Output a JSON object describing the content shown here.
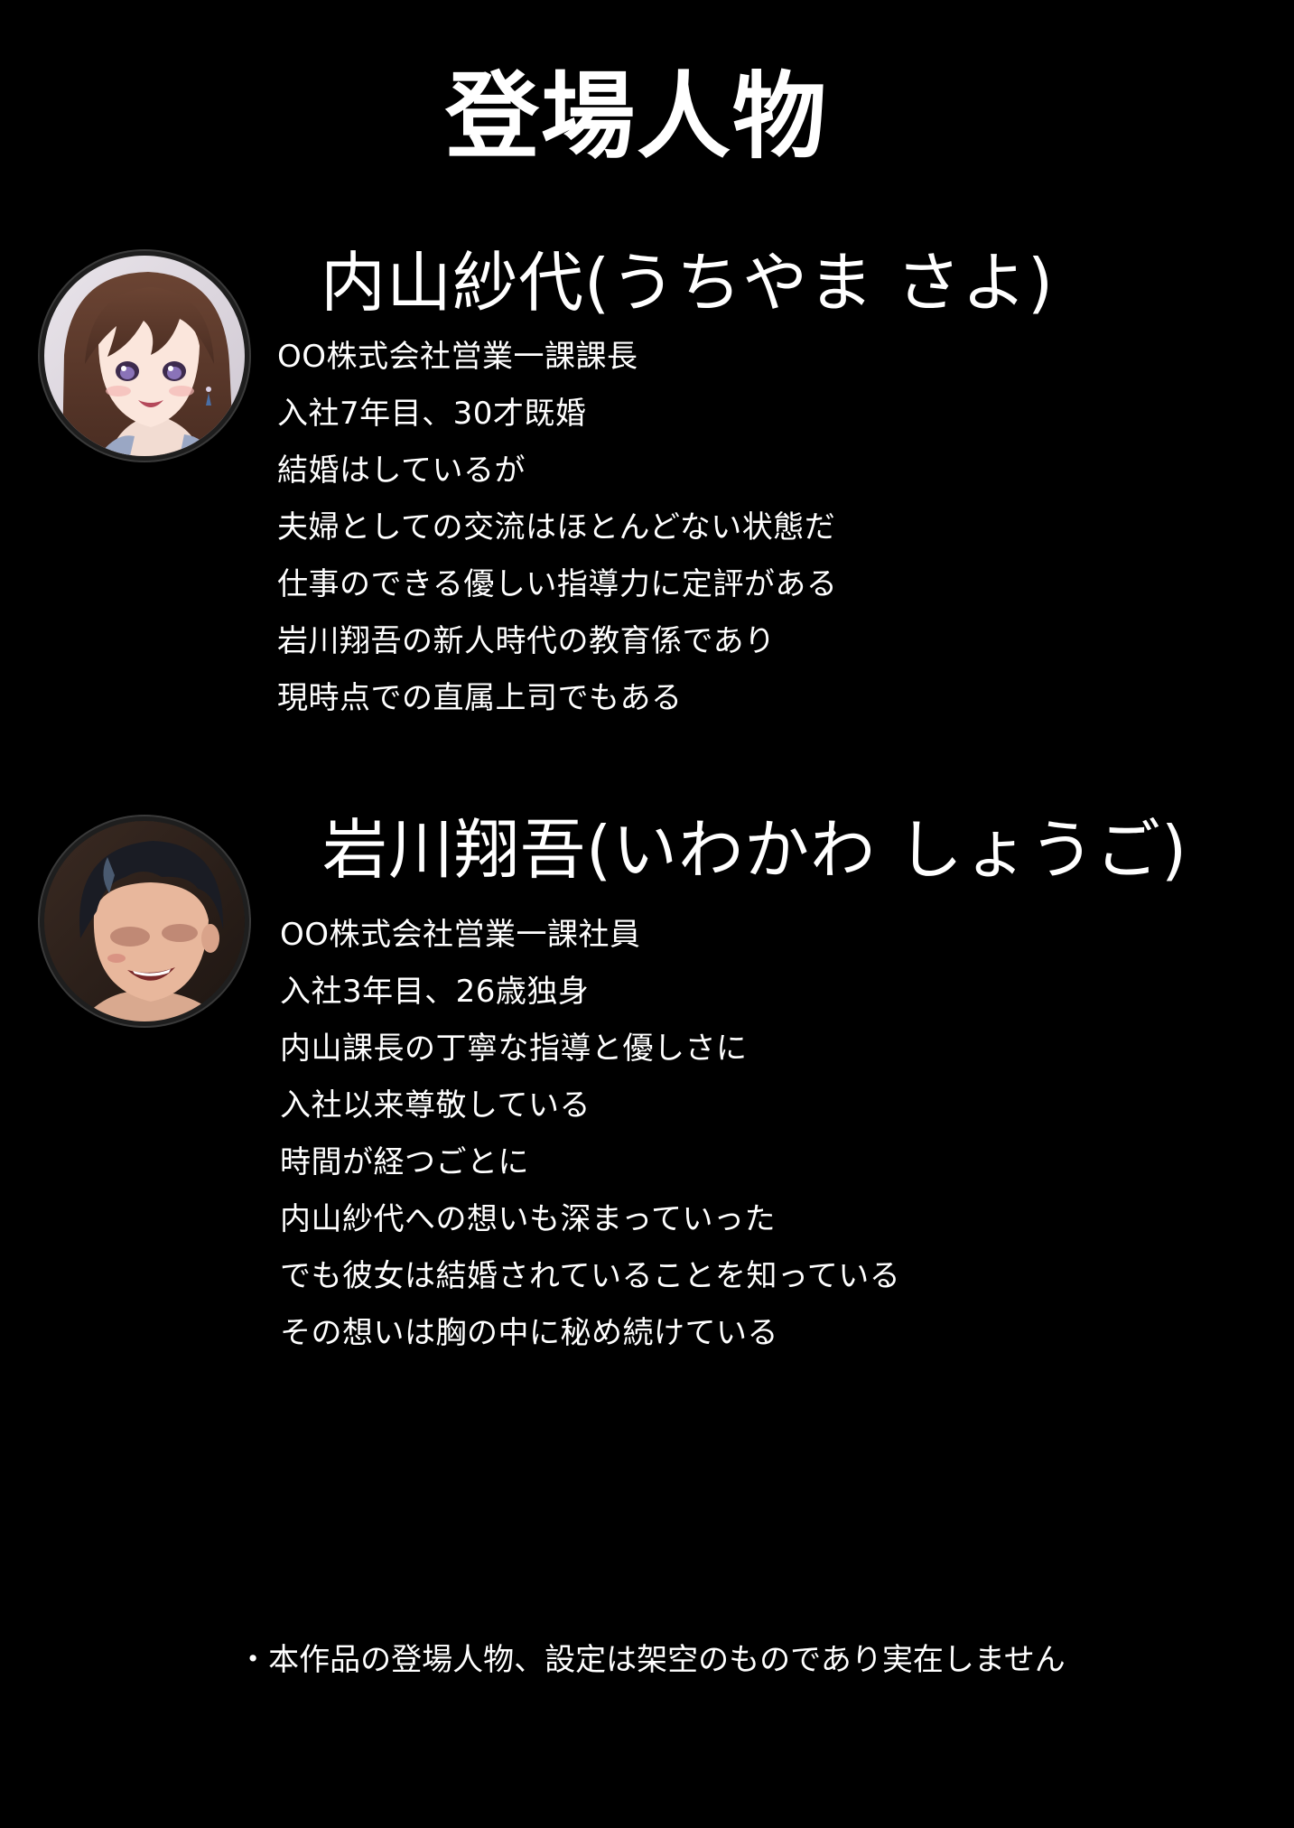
{
  "page": {
    "title": "登場人物",
    "disclaimer": "・本作品の登場人物、設定は架空のものであり実在しません"
  },
  "characters": [
    {
      "name": "内山紗代(うちやま さよ)",
      "avatar_icon": "woman-portrait-icon",
      "lines": [
        "OO株式会社営業一課課長",
        "入社7年目、30才既婚",
        "結婚はしているが",
        "夫婦としての交流はほとんどない状態だ",
        "仕事のできる優しい指導力に定評がある",
        "岩川翔吾の新人時代の教育係であり",
        "現時点での直属上司でもある"
      ]
    },
    {
      "name": "岩川翔吾(いわかわ しょうご)",
      "avatar_icon": "man-portrait-icon",
      "lines": [
        "OO株式会社営業一課社員",
        "入社3年目、26歳独身",
        "内山課長の丁寧な指導と優しさに",
        "入社以来尊敬している",
        "時間が経つごとに",
        "内山紗代への想いも深まっていった",
        "でも彼女は結婚されていることを知っている",
        "その想いは胸の中に秘め続けている"
      ]
    }
  ],
  "colors": {
    "background": "#000000",
    "text": "#ffffff"
  }
}
